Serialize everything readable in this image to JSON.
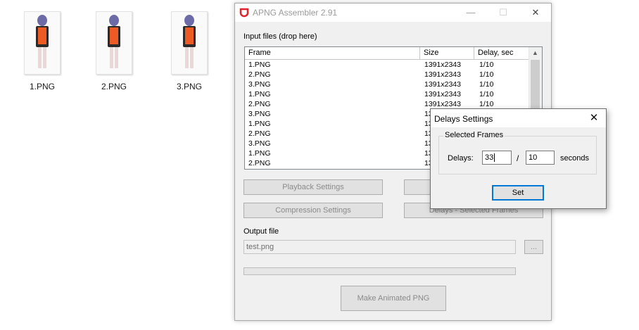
{
  "desktop": {
    "files": [
      {
        "label": "1.PNG"
      },
      {
        "label": "2.PNG"
      },
      {
        "label": "3.PNG"
      }
    ]
  },
  "window": {
    "title": "APNG Assembler 2.91",
    "minimize_glyph": "—",
    "maximize_glyph": "☐",
    "close_glyph": "✕",
    "input_label": "Input files (drop here)",
    "columns": [
      "Frame",
      "Size",
      "Delay, sec"
    ],
    "rows": [
      [
        "1.PNG",
        "1391x2343",
        "1/10"
      ],
      [
        "2.PNG",
        "1391x2343",
        "1/10"
      ],
      [
        "3.PNG",
        "1391x2343",
        "1/10"
      ],
      [
        "1.PNG",
        "1391x2343",
        "1/10"
      ],
      [
        "2.PNG",
        "1391x2343",
        "1/10"
      ],
      [
        "3.PNG",
        "13",
        ""
      ],
      [
        "1.PNG",
        "13",
        ""
      ],
      [
        "2.PNG",
        "13",
        ""
      ],
      [
        "3.PNG",
        "13",
        ""
      ],
      [
        "1.PNG",
        "13",
        ""
      ],
      [
        "2.PNG",
        "13",
        ""
      ]
    ],
    "scroll_up_glyph": "▲",
    "buttons": {
      "playback": "Playback Settings",
      "compression": "Compression Settings",
      "delays_selected": "Delays - Selected Frames",
      "make": "Make Animated PNG",
      "browse": "..."
    },
    "output_label": "Output file",
    "output_value": "test.png",
    "progress": 0
  },
  "dialog": {
    "title": "Delays Settings",
    "close_glyph": "✕",
    "group_title": "Selected Frames",
    "delays_label": "Delays:",
    "numerator": "33",
    "slash": "/",
    "denominator": "10",
    "unit": "seconds",
    "set_label": "Set"
  },
  "colors": {
    "app_icon": "#e0242b",
    "dialog_focus": "#0078d7"
  }
}
